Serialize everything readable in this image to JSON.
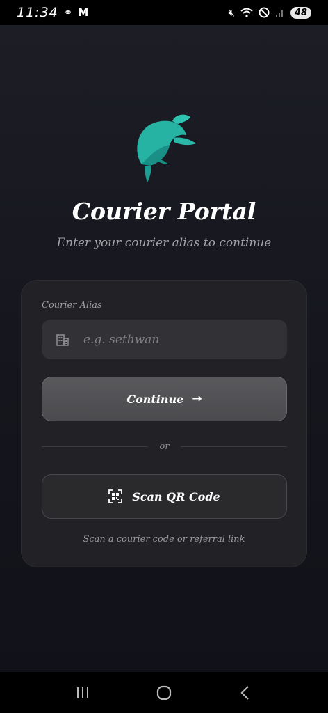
{
  "status_bar": {
    "time": "11:34",
    "notification_icons": [
      "link-icon",
      "gmail-icon"
    ],
    "system_icons": [
      "mute-icon",
      "wifi-icon",
      "do-not-disturb-icon",
      "signal-icon"
    ],
    "battery": "48"
  },
  "app": {
    "title": "Courier Portal",
    "subtitle": "Enter your courier alias to continue",
    "logo": "sea-turtle-logo",
    "accent_color": "#24b3a3"
  },
  "form": {
    "alias_label": "Courier Alias",
    "alias_placeholder": "e.g. sethwan",
    "alias_value": "",
    "continue_label": "Continue",
    "divider_text": "or",
    "scan_label": "Scan QR Code",
    "helper_text": "Scan a courier code or referral link"
  },
  "nav_bar": {
    "buttons": [
      "recent-apps",
      "home",
      "back"
    ]
  }
}
